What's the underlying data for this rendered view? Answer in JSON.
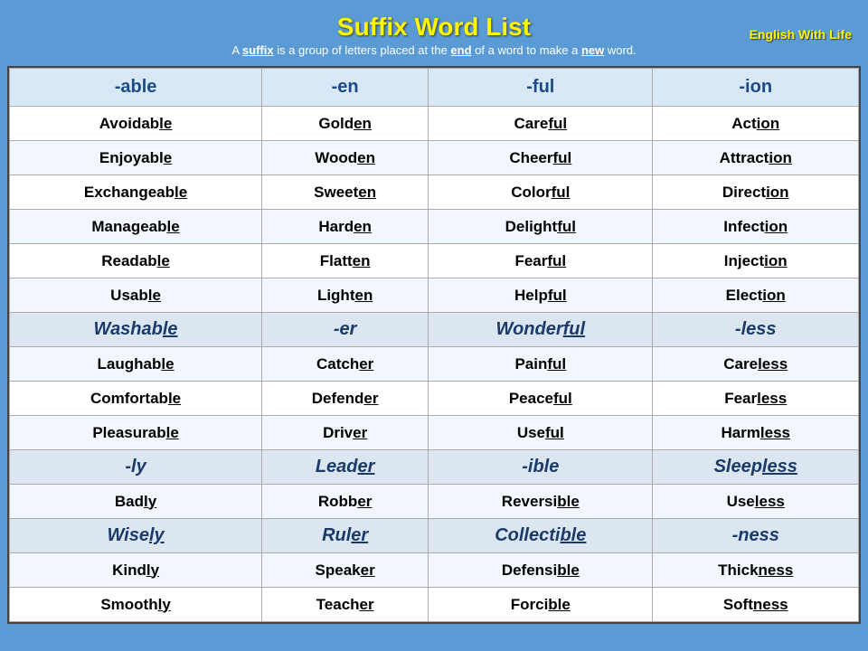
{
  "header": {
    "title": "Suffix Word List",
    "subtitle_plain": "A ",
    "subtitle_suffix": "suffix",
    "subtitle_mid": " is a group of letters placed at the end of a word to make a ",
    "subtitle_new": "new",
    "subtitle_end": " word.",
    "brand_line1": "English With Life"
  },
  "columns": [
    "-able",
    "-en",
    "-ful",
    "-ion"
  ],
  "rows": [
    [
      "Avoidable",
      "Golden",
      "Careful",
      "Action"
    ],
    [
      "Enjoyable",
      "Wooden",
      "Cheerful",
      "Attraction"
    ],
    [
      "Exchangeable",
      "Sweeten",
      "Colorful",
      "Direction"
    ],
    [
      "Manageable",
      "Harden",
      "Delightful",
      "Infection"
    ],
    [
      "Readable",
      "Flatten",
      "Fearful",
      "Injection"
    ],
    [
      "Usable",
      "Lighten",
      "Helpful",
      "Election"
    ],
    [
      "Washable",
      "-er",
      "Wonderful",
      "-less"
    ],
    [
      "Laughable",
      "Catcher",
      "Painful",
      "Careless"
    ],
    [
      "Comfortable",
      "Defender",
      "Peaceful",
      "Fearless"
    ],
    [
      "Pleasurable",
      "Driver",
      "Useful",
      "Harmless"
    ],
    [
      "-ly",
      "Leader",
      "-ible",
      "Sleepless"
    ],
    [
      "Badly",
      "Robber",
      "Reversible",
      "Useless"
    ],
    [
      "Wisely",
      "Ruler",
      "Collectible",
      "-ness"
    ],
    [
      "Kindly",
      "Speaker",
      "Defensible",
      "Thickness"
    ],
    [
      "Smoothly",
      "Teacher",
      "Forcible",
      "Softness"
    ]
  ],
  "suffix_rows": [
    6,
    10,
    12
  ],
  "underline_map": {
    "Avoidable": [
      7,
      11
    ],
    "Enjoyable": [
      8,
      12
    ],
    "Exchangeable": [
      10,
      14
    ],
    "Manageable": [
      8,
      12
    ],
    "Readable": [
      6,
      10
    ],
    "Usable": [
      4,
      8
    ],
    "Washable": [
      6,
      10
    ],
    "Laughable": [
      7,
      11
    ],
    "Comfortable": [
      9,
      13
    ],
    "Pleasurable": [
      9,
      13
    ],
    "Golden": [
      4,
      6
    ],
    "Wooden": [
      4,
      6
    ],
    "Sweeten": [
      5,
      7
    ],
    "Harden": [
      4,
      6
    ],
    "Flatten": [
      5,
      7
    ],
    "Lighten": [
      5,
      7
    ],
    "Catcher": [
      5,
      7
    ],
    "Defender": [
      6,
      8
    ],
    "Driver": [
      4,
      6
    ],
    "Leader": [
      4,
      6
    ],
    "Robber": [
      4,
      6
    ],
    "Ruler": [
      3,
      5
    ],
    "Speaker": [
      5,
      7
    ],
    "Teacher": [
      5,
      7
    ],
    "Careful": [
      4,
      7
    ],
    "Cheerful": [
      5,
      8
    ],
    "Colorful": [
      5,
      8
    ],
    "Delightful": [
      7,
      10
    ],
    "Fearful": [
      4,
      7
    ],
    "Helpful": [
      4,
      7
    ],
    "Wonderful": [
      6,
      9
    ],
    "Painful": [
      4,
      7
    ],
    "Peaceful": [
      5,
      8
    ],
    "Useful": [
      3,
      6
    ],
    "Reversible": [
      7,
      11
    ],
    "Collectible": [
      8,
      12
    ],
    "Defensible": [
      7,
      11
    ],
    "Forcible": [
      5,
      9
    ],
    "Action": [
      3,
      6
    ],
    "Attraction": [
      7,
      10
    ],
    "Direction": [
      6,
      9
    ],
    "Infection": [
      6,
      9
    ],
    "Injection": [
      6,
      9
    ],
    "Election": [
      5,
      8
    ],
    "Careless": [
      4,
      8
    ],
    "Fearless": [
      4,
      8
    ],
    "Harmless": [
      4,
      8
    ],
    "Sleepless": [
      5,
      9
    ],
    "Useless": [
      3,
      7
    ],
    "Thickness": [
      5,
      9
    ],
    "Softness": [
      4,
      8
    ],
    "Badly": [
      3,
      5
    ],
    "Wisely": [
      4,
      6
    ],
    "Kindly": [
      4,
      6
    ],
    "Smoothly": [
      6,
      8
    ]
  }
}
